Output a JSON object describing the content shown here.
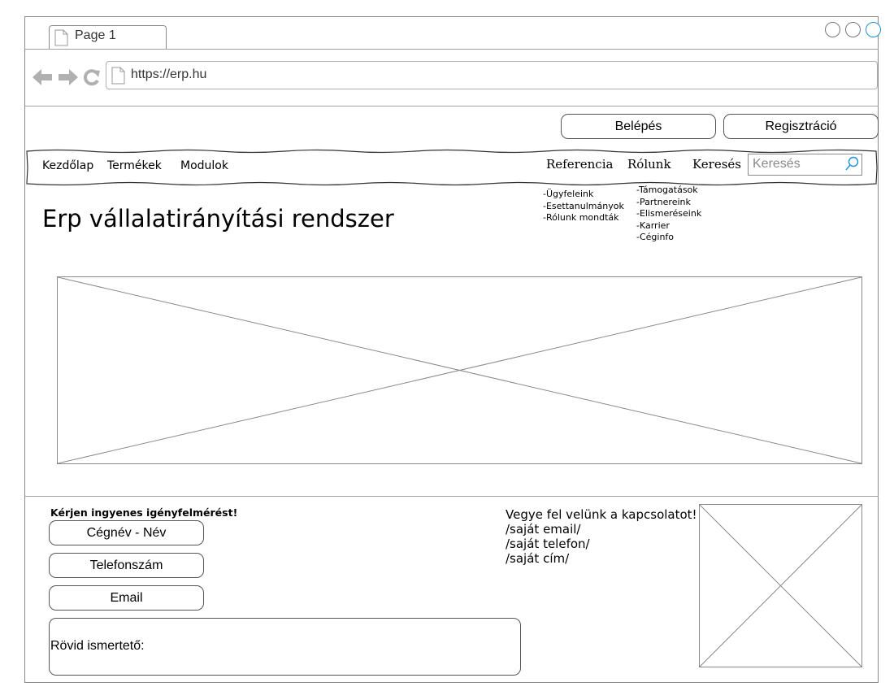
{
  "browser": {
    "tab_title": "Page 1",
    "url": "https://erp.hu",
    "nav_icons": [
      "back-arrow-icon",
      "forward-arrow-icon",
      "reload-icon"
    ],
    "window_controls": [
      "window-circle-1",
      "window-circle-2",
      "window-circle-3"
    ],
    "active_control_color": "#1e90d6"
  },
  "header": {
    "login_label": "Belépés",
    "register_label": "Regisztráció"
  },
  "nav": {
    "left_items": [
      "Kezdőlap",
      "Termékek",
      "Modulok"
    ],
    "right_items": [
      "Referencia",
      "Rólunk",
      "Keresés"
    ],
    "search_placeholder": "Keresés"
  },
  "submenus": {
    "referencia": [
      "-Ügyfeleink",
      "-Esettanulmányok",
      "-Rólunk mondták"
    ],
    "rolunk": [
      "-Támogatások",
      "-Partnereink",
      "-Elismeréseink",
      "-Karrier",
      "-Céginfo"
    ]
  },
  "main": {
    "title": "Erp vállalatirányítási rendszer"
  },
  "form": {
    "heading": "Kérjen ingyenes igényfelmérést!",
    "fields": [
      "Cégnév - Név",
      "Telefonszám",
      "Email"
    ],
    "textarea_label": "Rövid ismertető:"
  },
  "contact": {
    "lines": [
      "Vegye fel velünk a kapcsolatot!",
      "/saját email/",
      "/saját telefon/",
      "/saját cím/"
    ]
  }
}
